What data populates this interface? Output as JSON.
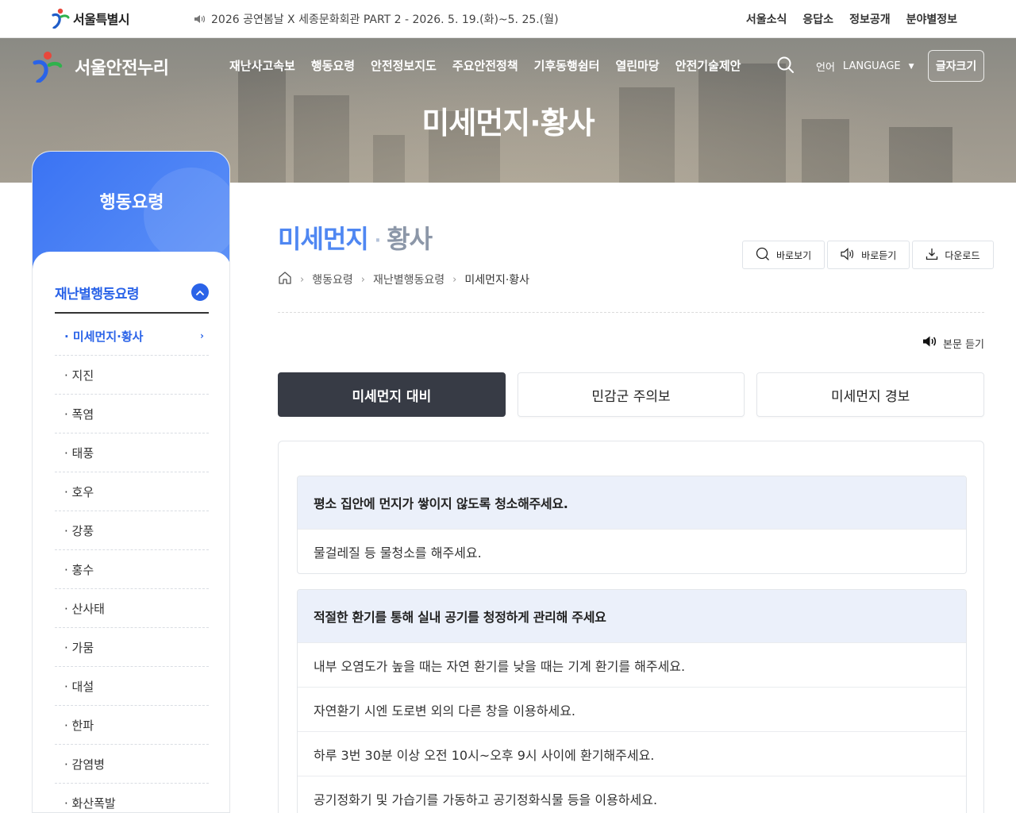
{
  "topbar": {
    "seoul_logo": "서울특별시",
    "notice": "2026 공연봄날 X 세종문화회관 PART 2 - 2026. 5. 19.(화)~5. 25.(월)",
    "links": [
      "서울소식",
      "응답소",
      "정보공개",
      "분야별정보"
    ]
  },
  "header": {
    "brand": "서울안전누리",
    "gnb": [
      "재난사고속보",
      "행동요령",
      "안전정보지도",
      "주요안전정책",
      "기후동행쉼터",
      "열린마당",
      "안전기술제안"
    ],
    "lang_label": "언어",
    "lang_value": "LANGUAGE",
    "fontsize": "글자크기",
    "hero_title": "미세먼지·황사"
  },
  "sidebar": {
    "title": "행동요령",
    "group": "재난별행동요령",
    "items": [
      "· 미세먼지·황사",
      "· 지진",
      "· 폭염",
      "· 태풍",
      "· 호우",
      "· 강풍",
      "· 홍수",
      "· 산사태",
      "· 가뭄",
      "· 대설",
      "· 한파",
      "· 감염병",
      "· 화산폭발"
    ]
  },
  "content": {
    "heading_a": "미세먼지",
    "heading_dot": "·",
    "heading_b": "황사",
    "tools": [
      "바로보기",
      "바로듣기",
      "다운로드"
    ],
    "breadcrumb": [
      "행동요령",
      "재난별행동요령",
      "미세먼지·황사"
    ],
    "listen": "본문 듣기",
    "tabs": [
      "미세먼지 대비",
      "민감군 주의보",
      "미세먼지 경보"
    ],
    "cards": [
      {
        "title": "평소 집안에 먼지가 쌓이지 않도록 청소해주세요.",
        "rows": [
          "물걸레질 등 물청소를 해주세요."
        ]
      },
      {
        "title": "적절한 환기를 통해 실내 공기를 청정하게 관리해 주세요",
        "rows": [
          "내부 오염도가 높을 때는 자연 환기를 낮을 때는 기계 환기를 해주세요.",
          "자연환기 시엔 도로변 외의 다른 창을 이용하세요.",
          "하루 3번 30분 이상 오전 10시~오후 9시 사이에 환기해주세요.",
          "공기정화기 및 가습기를 가동하고 공기정화식물 등을 이용하세요."
        ]
      }
    ]
  },
  "colors": {
    "accent": "#2a63e8",
    "tab_active": "#373b45",
    "card_header": "#ebf0fa"
  }
}
